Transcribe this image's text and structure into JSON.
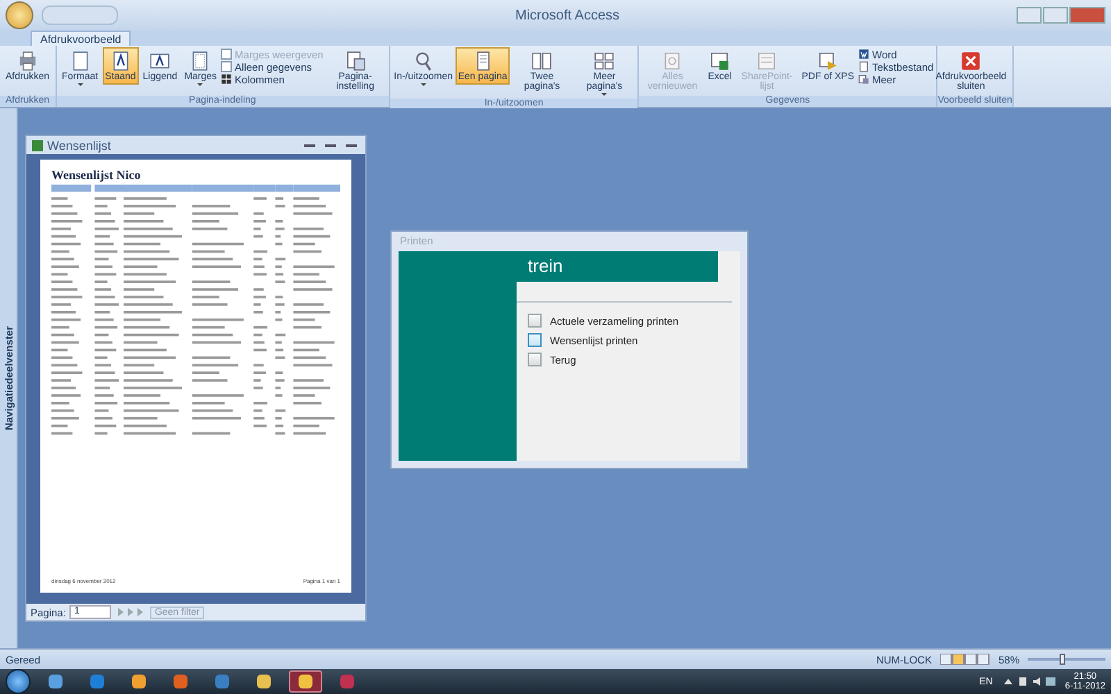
{
  "window": {
    "title": "Microsoft Access"
  },
  "tabs": [
    {
      "label": "Afdrukvoorbeeld",
      "selected": true
    }
  ],
  "ribbon": {
    "groups": [
      {
        "label": "Afdrukken",
        "items": [
          {
            "kind": "large",
            "label": "Afdrukken",
            "selected": false,
            "disabled": false,
            "dropdown": false
          }
        ]
      },
      {
        "label": "Pagina-indeling",
        "items": [
          {
            "kind": "large",
            "label": "Formaat",
            "selected": false,
            "disabled": false,
            "dropdown": true
          },
          {
            "kind": "large",
            "label": "Staand",
            "selected": true,
            "disabled": false,
            "dropdown": false
          },
          {
            "kind": "large",
            "label": "Liggend",
            "selected": false,
            "disabled": false,
            "dropdown": false
          },
          {
            "kind": "large",
            "label": "Marges",
            "selected": false,
            "disabled": false,
            "dropdown": true
          },
          {
            "kind": "stack",
            "items": [
              {
                "kind": "check",
                "label": "Marges weergeven",
                "checked": false,
                "disabled": true
              },
              {
                "kind": "check",
                "label": "Alleen gegevens",
                "checked": false,
                "disabled": false
              },
              {
                "kind": "small",
                "label": "Kolommen",
                "disabled": false
              }
            ]
          },
          {
            "kind": "large",
            "label": "Pagina-instelling",
            "selected": false,
            "disabled": false,
            "dropdown": false
          }
        ]
      },
      {
        "label": "In-/uitzoomen",
        "items": [
          {
            "kind": "large",
            "label": "In-/uitzoomen",
            "selected": false,
            "disabled": false,
            "dropdown": true
          },
          {
            "kind": "large",
            "label": "Een pagina",
            "selected": true,
            "disabled": false,
            "dropdown": false
          },
          {
            "kind": "large",
            "label": "Twee pagina's",
            "selected": false,
            "disabled": false,
            "dropdown": false
          },
          {
            "kind": "large",
            "label": "Meer pagina's",
            "selected": false,
            "disabled": false,
            "dropdown": true
          }
        ]
      },
      {
        "label": "Gegevens",
        "items": [
          {
            "kind": "large",
            "label": "Alles vernieuwen",
            "selected": false,
            "disabled": true,
            "dropdown": false
          },
          {
            "kind": "large",
            "label": "Excel",
            "selected": false,
            "disabled": false,
            "dropdown": false
          },
          {
            "kind": "large",
            "label": "SharePoint-lijst",
            "selected": false,
            "disabled": true,
            "dropdown": false
          },
          {
            "kind": "large",
            "label": "PDF of XPS",
            "selected": false,
            "disabled": false,
            "dropdown": false
          },
          {
            "kind": "stack",
            "items": [
              {
                "kind": "small",
                "label": "Word",
                "disabled": false
              },
              {
                "kind": "small",
                "label": "Tekstbestand",
                "disabled": false
              },
              {
                "kind": "small",
                "label": "Meer",
                "disabled": false
              }
            ]
          }
        ]
      },
      {
        "label": "Voorbeeld sluiten",
        "items": [
          {
            "kind": "large",
            "label": "Afdrukvoorbeeld sluiten",
            "selected": false,
            "disabled": false,
            "dropdown": false
          }
        ]
      }
    ]
  },
  "navigation_pane": {
    "label": "Navigatiedeelvenster"
  },
  "report_window": {
    "title": "Wensenlijst",
    "report_title": "Wensenlijst Nico",
    "footer_date": "dinsdag 6 november 2012",
    "footer_page": "Pagina 1 van 1",
    "nav_label": "Pagina:",
    "page": "1",
    "filter": "Geen filter"
  },
  "dialog": {
    "title": "Printen",
    "header": "trein",
    "buttons": [
      {
        "label": "Actuele verzameling printen",
        "selected": false
      },
      {
        "label": "Wensenlijst printen",
        "selected": true
      },
      {
        "label": "Terug",
        "selected": false
      }
    ]
  },
  "status_bar": {
    "text": "Gereed",
    "numlock": "NUM-LOCK",
    "zoom": "58%",
    "level": 0.45
  },
  "taskbar": {
    "apps": [
      {
        "selected": false
      },
      {
        "selected": false
      },
      {
        "selected": false
      },
      {
        "selected": false
      },
      {
        "selected": false
      },
      {
        "selected": false
      },
      {
        "selected": true
      },
      {
        "selected": false
      }
    ],
    "language": "EN",
    "time": "21:50",
    "date": "6-11-2012"
  }
}
